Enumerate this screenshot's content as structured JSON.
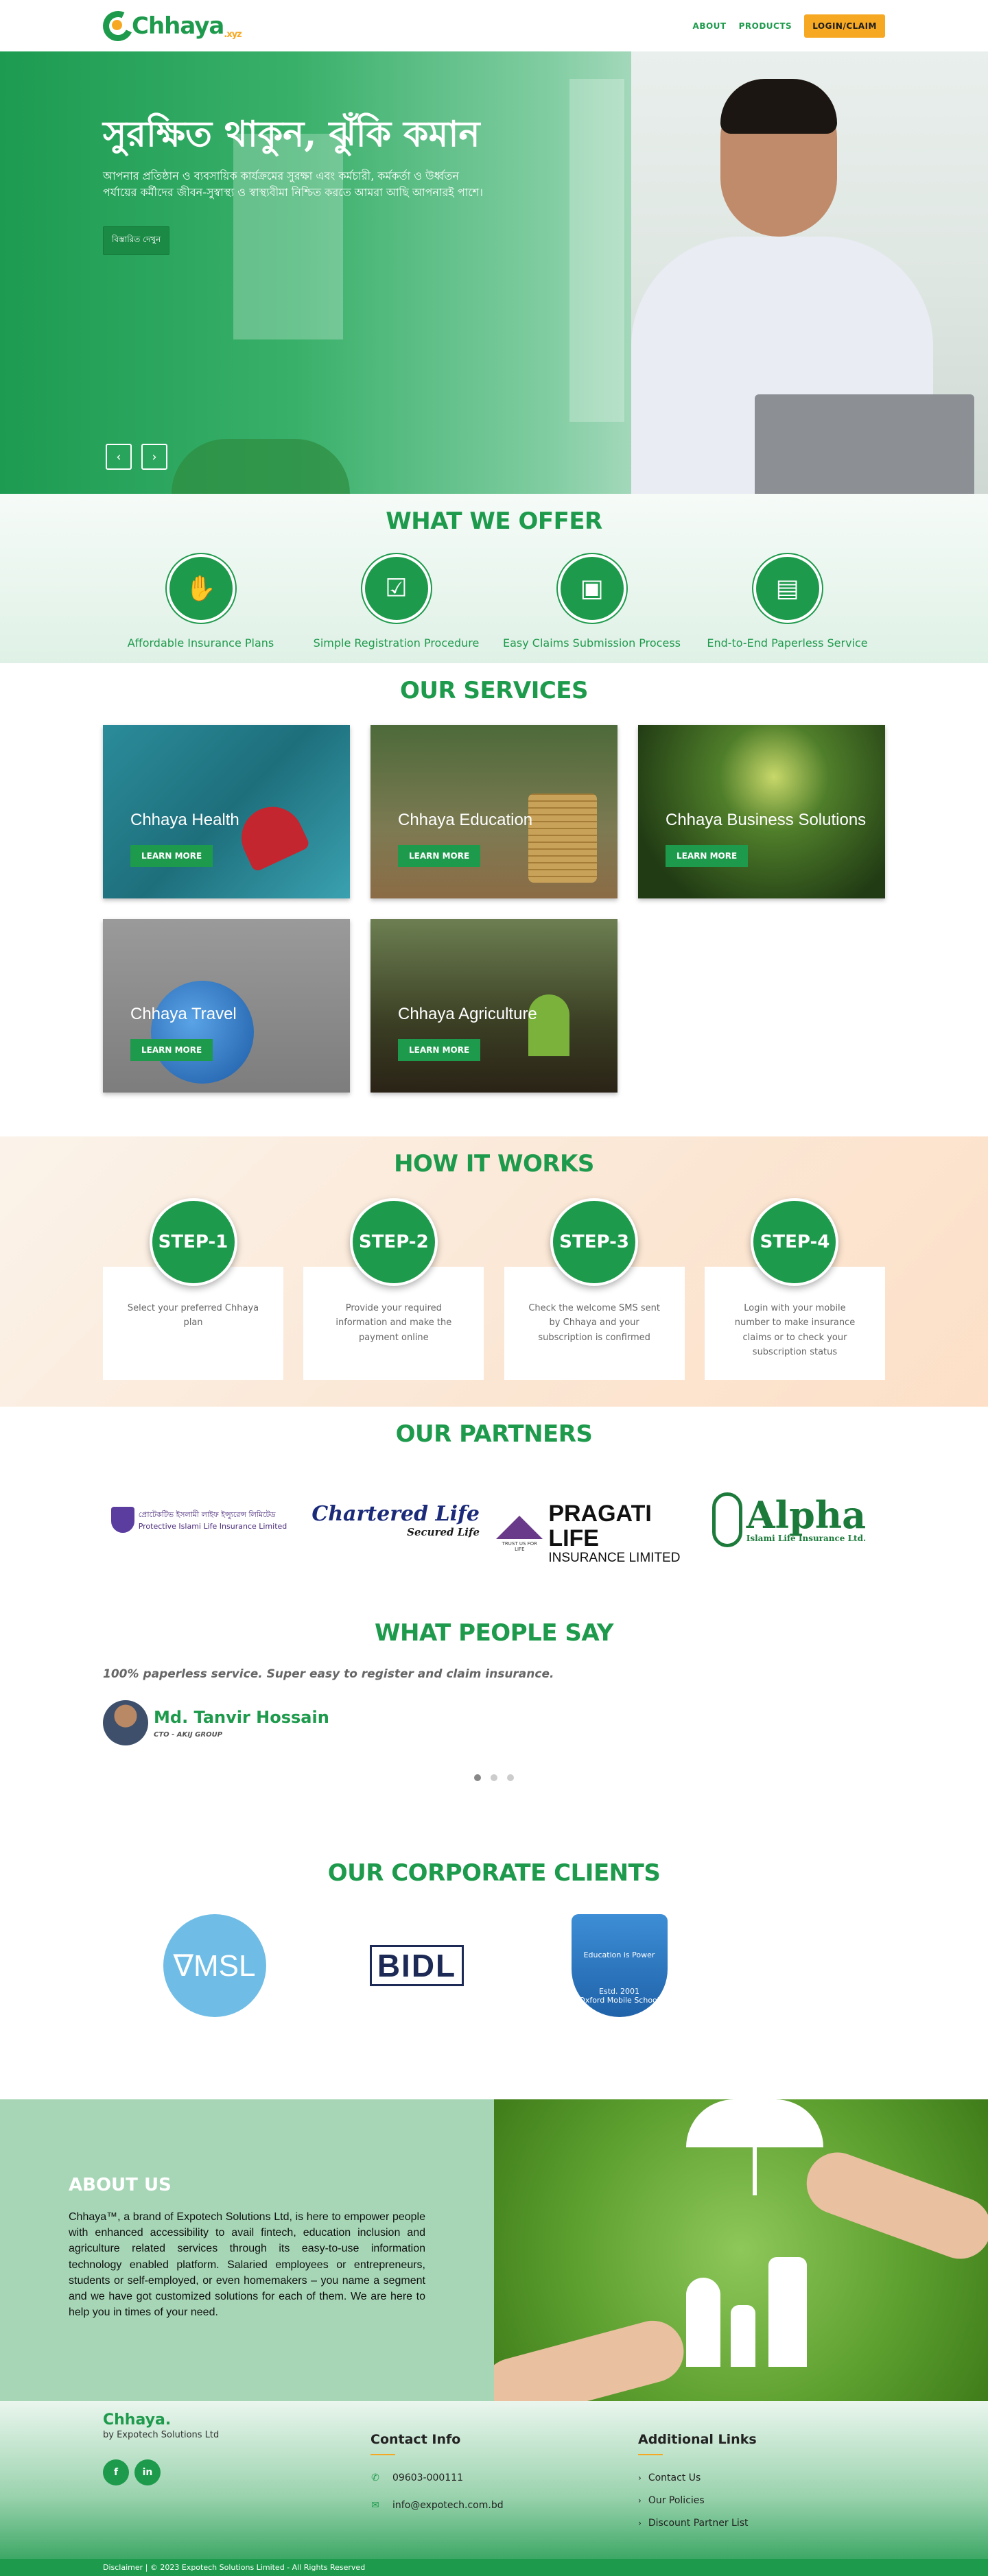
{
  "brand": {
    "name": "Chhaya",
    "suffix": ".xyz"
  },
  "nav": {
    "links": [
      "ABOUT",
      "PRODUCTS"
    ],
    "login_label": "LOGIN/CLAIM"
  },
  "hero": {
    "title": "সুরক্ষিত থাকুন, ঝুঁকি কমান",
    "subtitle": "আপনার প্রতিষ্ঠান ও ব্যবসায়িক কার্যক্রমের সুরক্ষা এবং কর্মচারী, কর্মকর্তা ও উর্ধ্বতন পর্যায়ের কর্মীদের জীবন-সুস্বাস্থ্য ও স্বাস্থ্যবীমা নিশ্চিত করতে আমরা আছি আপনারই পাশে।",
    "cta_label": "বিস্তারিত দেখুন",
    "prev_icon": "chevron-left-icon",
    "next_icon": "chevron-right-icon"
  },
  "offer": {
    "title": "WHAT WE OFFER",
    "items": [
      {
        "label": "Affordable Insurance Plans",
        "icon": "hand-coin-icon"
      },
      {
        "label": "Simple Registration Procedure",
        "icon": "phone-checklist-icon"
      },
      {
        "label": "Easy Claims Submission Process",
        "icon": "browser-window-icon"
      },
      {
        "label": "End-to-End Paperless Service",
        "icon": "document-mouse-icon"
      }
    ]
  },
  "services": {
    "title": "OUR SERVICES",
    "button_label": "LEARN MORE",
    "items": [
      {
        "label": "Chhaya Health"
      },
      {
        "label": "Chhaya Education"
      },
      {
        "label": "Chhaya Business Solutions"
      },
      {
        "label": "Chhaya Travel"
      },
      {
        "label": "Chhaya Agriculture"
      }
    ]
  },
  "how": {
    "title": "HOW IT WORKS",
    "steps": [
      {
        "label": "STEP-1",
        "text": "Select your preferred Chhaya plan"
      },
      {
        "label": "STEP-2",
        "text": "Provide your required information and make the payment online"
      },
      {
        "label": "STEP-3",
        "text": "Check the welcome SMS sent by Chhaya and your subscription is confirmed"
      },
      {
        "label": "STEP-4",
        "text": "Login with your mobile number to make insurance claims or to check your subscription status"
      }
    ]
  },
  "partners": {
    "title": "OUR PARTNERS",
    "protective": {
      "line1": "প্রোটেকটিভ ইসলামী লাইফ ইন্স্যুরেন্স লিমিটেড",
      "line2": "Protective Islami Life Insurance Limited"
    },
    "chartered": {
      "line1": "Chartered Life",
      "line2": "Secured Life"
    },
    "pragati": {
      "line1": "PRAGATI LIFE",
      "line2": "INSURANCE LIMITED",
      "tagline": "TRUST US FOR LIFE"
    },
    "alpha": {
      "line1": "Alpha",
      "line2": "Islami Life Insurance Ltd."
    }
  },
  "testimonial": {
    "title": "WHAT PEOPLE SAY",
    "quote": "100% paperless service. Super easy to register and claim insurance.",
    "name": "Md. Tanvir Hossain",
    "role": "CTO - AKIJ GROUP"
  },
  "clients": {
    "title": "OUR CORPORATE CLIENTS",
    "vmsl": "∇MSL",
    "bidl": "BIDL",
    "oxford": {
      "top": "Education is Power",
      "est": "Estd. 2001",
      "name": "Oxford Mobile School"
    }
  },
  "about": {
    "title": "ABOUT US",
    "text": "Chhaya™, a brand of Expotech Solutions Ltd, is here to empower people with enhanced accessibility to avail fintech, education inclusion and agriculture related services through its easy-to-use information technology enabled platform. Salaried employees or entrepreneurs, students or self-employed, or even homemakers – you name a segment and we have got customized solutions for each of them. We are here to help you in times of your need."
  },
  "footer": {
    "logo": "Chhaya.",
    "by": "by Expotech Solutions Ltd",
    "social": [
      "f",
      "in"
    ],
    "contact_title": "Contact Info",
    "phone": "09603-000111",
    "email": "info@expotech.com.bd",
    "links_title": "Additional Links",
    "links": [
      "Contact Us",
      "Our Policies",
      "Discount Partner List"
    ],
    "disclaimer": "Disclaimer",
    "copyright": " | © 2023 Expotech Solutions Limited - All Rights Reserved"
  },
  "colors": {
    "primary": "#1e9a4c",
    "accent": "#f7a823"
  }
}
